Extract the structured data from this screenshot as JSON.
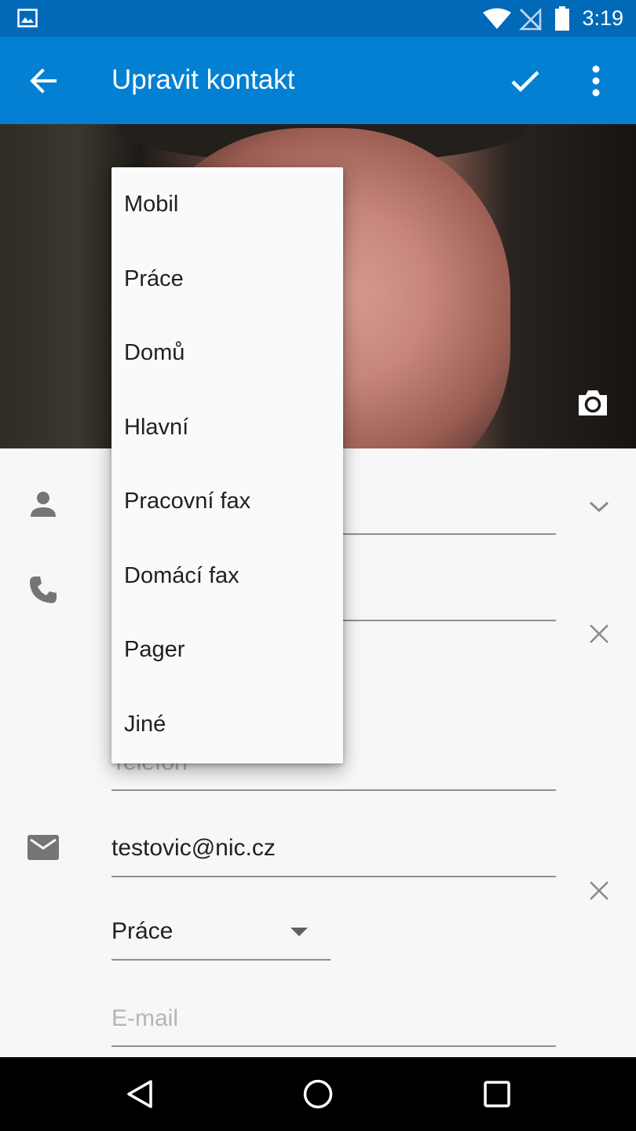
{
  "status_bar": {
    "time": "3:19"
  },
  "app_bar": {
    "title": "Upravit kontakt"
  },
  "icons": {
    "gallery": "image-icon",
    "wifi": "wifi-icon",
    "signal": "no-signal-icon",
    "battery": "battery-icon",
    "back": "arrow-left-icon",
    "save": "check-icon",
    "overflow": "more-vert-icon",
    "camera": "camera-icon",
    "person": "person-icon",
    "phone": "phone-icon",
    "email": "email-icon",
    "expand": "chevron-down-icon",
    "remove": "close-icon",
    "dropdown": "arrow-drop-down-icon"
  },
  "phone_section": {
    "new_hint": "Telefon"
  },
  "email_section": {
    "value": "testovic@nic.cz",
    "type": "Práce",
    "new_hint": "E-mail"
  },
  "phone_type_menu": {
    "items": [
      "Mobil",
      "Práce",
      "Domů",
      "Hlavní",
      "Pracovní fax",
      "Domácí fax",
      "Pager",
      "Jiné"
    ]
  },
  "colors": {
    "status_bar": "#0069b8",
    "app_bar": "#0480d3",
    "background": "#f7f7f7",
    "menu": "#fafafa"
  }
}
